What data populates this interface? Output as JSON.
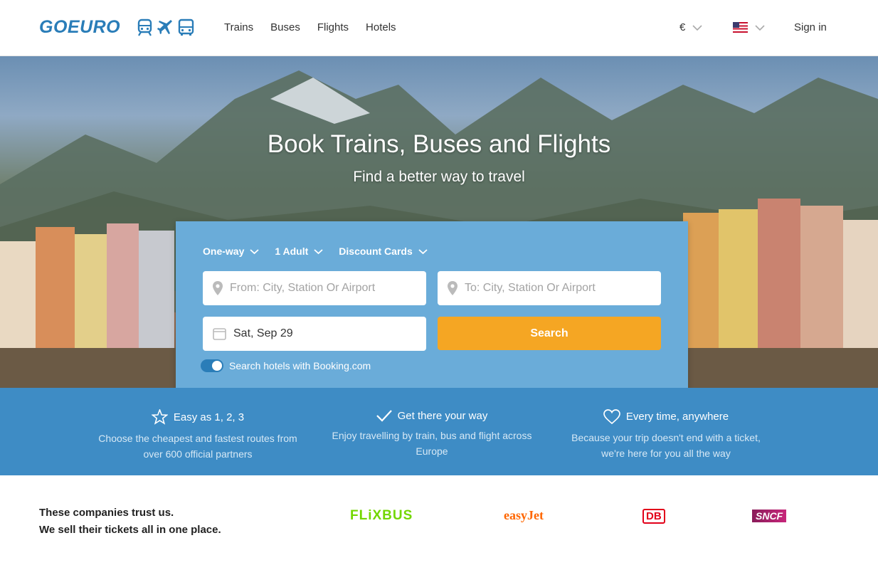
{
  "header": {
    "logo": "GOEURO",
    "nav": [
      "Trains",
      "Buses",
      "Flights",
      "Hotels"
    ],
    "currency": "€",
    "signin": "Sign in"
  },
  "hero": {
    "title": "Book Trains, Buses and Flights",
    "subtitle": "Find a better way to travel"
  },
  "search": {
    "trip_type": "One-way",
    "passengers": "1 Adult",
    "discount": "Discount Cards",
    "from_placeholder": "From: City, Station Or Airport",
    "to_placeholder": "To: City, Station Or Airport",
    "date": "Sat, Sep 29",
    "button": "Search",
    "hotels_toggle": "Search hotels with Booking.com"
  },
  "features": [
    {
      "icon": "star-icon",
      "title": "Easy as 1, 2, 3",
      "desc_1": "Choose the cheapest and fastest routes from",
      "desc_2": "over 600 official partners"
    },
    {
      "icon": "check-icon",
      "title": "Get there your way",
      "desc_1": "Enjoy travelling by train, bus and flight across",
      "desc_2": "Europe"
    },
    {
      "icon": "heart-icon",
      "title": "Every time, anywhere",
      "desc_1": "Because your trip doesn't end with a ticket,",
      "desc_2": "we're here for you all the way"
    }
  ],
  "partners": {
    "line1": "These companies trust us.",
    "line2": "We sell their tickets all in one place.",
    "logos": [
      "FLiXBUS",
      "easyJet",
      "DB",
      "SNCF"
    ]
  },
  "colors": {
    "brand": "#2a7db8",
    "card": "#6aacd9",
    "search": "#f5a623",
    "band": "#3e8cc5"
  }
}
